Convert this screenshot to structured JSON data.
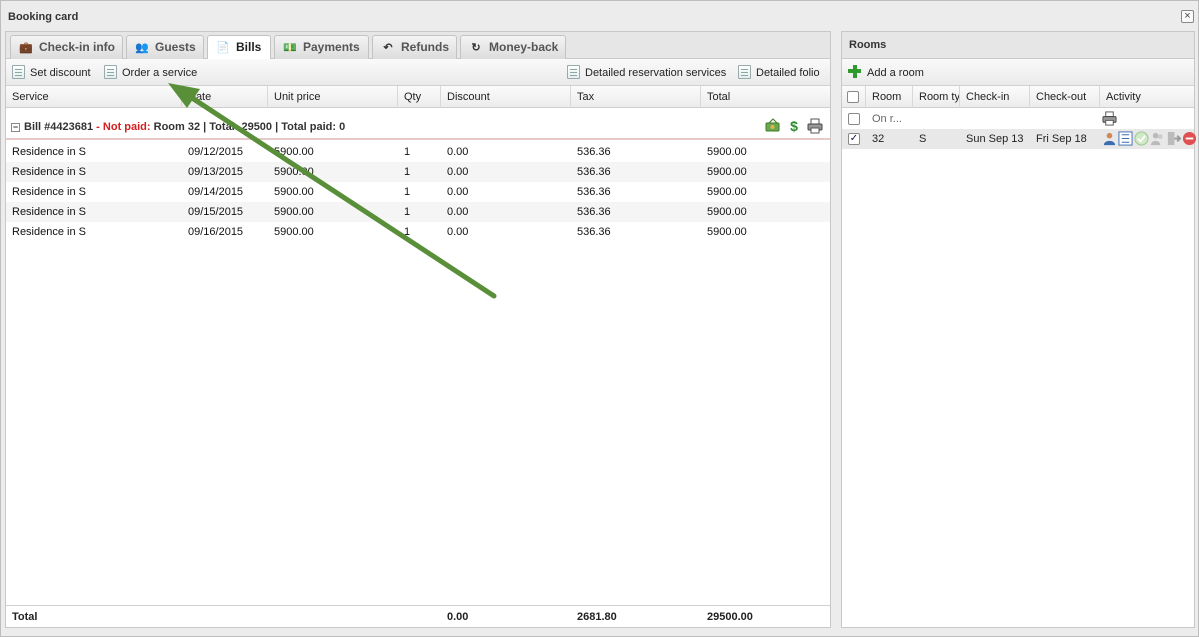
{
  "window": {
    "title": "Booking card",
    "close_label": "×"
  },
  "tabs": [
    {
      "label": "Check-in info",
      "icon": "briefcase-icon",
      "glyph": "💼"
    },
    {
      "label": "Guests",
      "icon": "users-icon",
      "glyph": "👥"
    },
    {
      "label": "Bills",
      "icon": "document-icon",
      "glyph": "📄",
      "active": true
    },
    {
      "label": "Payments",
      "icon": "banknote-icon",
      "glyph": "💵"
    },
    {
      "label": "Refunds",
      "icon": "undo-arrow-icon",
      "glyph": "↶"
    },
    {
      "label": "Money-back",
      "icon": "rotate-icon",
      "glyph": "↻"
    }
  ],
  "toolbar": {
    "set_discount": "Set discount",
    "order_service": "Order a service",
    "detailed_reservation": "Detailed reservation services",
    "detailed_folio": "Detailed folio"
  },
  "columns": {
    "service": "Service",
    "date": "Date",
    "unit_price": "Unit price",
    "qty": "Qty",
    "discount": "Discount",
    "tax": "Tax",
    "total": "Total"
  },
  "bill": {
    "expander": "−",
    "label": "Bill #4423681",
    "separator": " - ",
    "status": "Not paid:",
    "summary": " Room 32  |  Total: 29500  |  Total paid: 0"
  },
  "rows": [
    {
      "service": "Residence in S",
      "date": "09/12/2015",
      "unit_price": "5900.00",
      "qty": "1",
      "discount": "0.00",
      "tax": "536.36",
      "total": "5900.00"
    },
    {
      "service": "Residence in S",
      "date": "09/13/2015",
      "unit_price": "5900.00",
      "qty": "1",
      "discount": "0.00",
      "tax": "536.36",
      "total": "5900.00"
    },
    {
      "service": "Residence in S",
      "date": "09/14/2015",
      "unit_price": "5900.00",
      "qty": "1",
      "discount": "0.00",
      "tax": "536.36",
      "total": "5900.00"
    },
    {
      "service": "Residence in S",
      "date": "09/15/2015",
      "unit_price": "5900.00",
      "qty": "1",
      "discount": "0.00",
      "tax": "536.36",
      "total": "5900.00"
    },
    {
      "service": "Residence in S",
      "date": "09/16/2015",
      "unit_price": "5900.00",
      "qty": "1",
      "discount": "0.00",
      "tax": "536.36",
      "total": "5900.00"
    }
  ],
  "totals": {
    "label": "Total",
    "discount": "0.00",
    "tax": "2681.80",
    "total": "29500.00"
  },
  "rooms": {
    "title": "Rooms",
    "add_room": "Add a room",
    "columns": {
      "room": "Room",
      "room_type": "Room ty",
      "check_in": "Check-in",
      "check_out": "Check-out",
      "activity": "Activity"
    },
    "placeholder_row": {
      "room": "On r..."
    },
    "rows": [
      {
        "checked": "✓",
        "room": "32",
        "room_type": "S",
        "check_in": "Sun Sep 13",
        "check_out": "Fri Sep 18"
      }
    ]
  },
  "colors": {
    "not_paid": "#d42020",
    "arrow": "#5a8f3a"
  }
}
